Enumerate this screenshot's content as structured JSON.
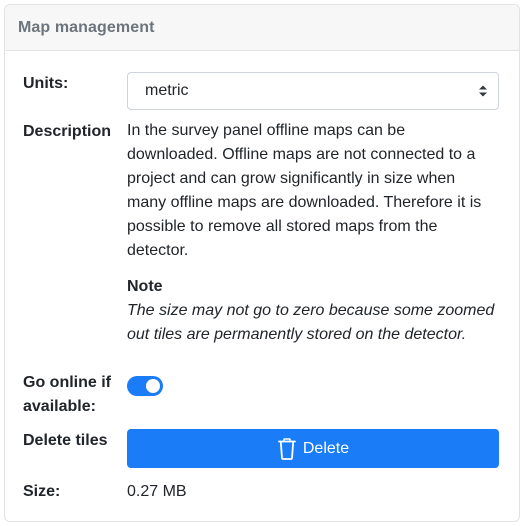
{
  "header": {
    "title": "Map management"
  },
  "units": {
    "label": "Units:",
    "selected": "metric"
  },
  "description": {
    "label": "Description",
    "text": "In the survey panel offline maps can be downloaded. Offline maps are not connected to a project and can grow significantly in size when many offline maps are downloaded. Therefore it is possible to remove all stored maps from the detector.",
    "note_title": "Note",
    "note_text": "The size may not go to zero because some zoomed out tiles are permanently stored on the detector."
  },
  "online": {
    "label": "Go online if available:",
    "enabled": true
  },
  "delete_tiles": {
    "label": "Delete tiles",
    "button_label": "Delete"
  },
  "size": {
    "label": "Size:",
    "value": "0.27 MB"
  },
  "colors": {
    "accent": "#1a7cf7",
    "header_bg": "#f7f7f7",
    "header_text": "#6c757d"
  },
  "icons": {
    "select_caret": "chevron-up-down-icon",
    "delete": "trash-icon"
  }
}
